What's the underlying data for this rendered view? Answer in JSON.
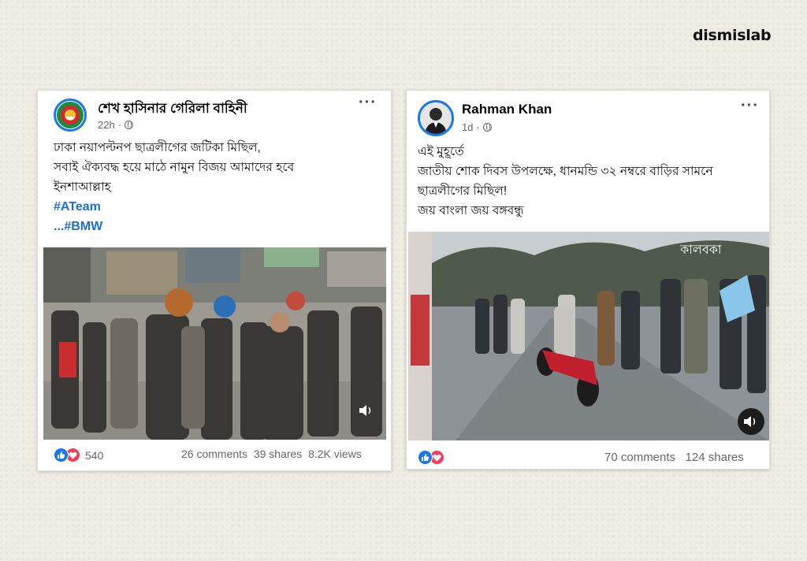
{
  "brand": "dismislab",
  "post1": {
    "author": "শেখ হাসিনার গেরিলা বাহিনী",
    "time": "22h",
    "text_lines": [
      "ঢাকা নয়াপল্টনপ ছাত্রলীগের জটিকা মিছিল,",
      "সবাই ঐক্যবদ্ধ হয়ে মাঠে নামুন বিজয় আমাদের হবে",
      "ইনশাআল্লাহ"
    ],
    "hashtags": [
      "#ATeam",
      "...#BMW"
    ],
    "reaction_count": "540",
    "comments": "26 comments",
    "shares": "39 shares",
    "views": "8.2K views"
  },
  "post2": {
    "author": "Rahman Khan",
    "time": "1d",
    "text_lines": [
      "এই মুহূর্তে",
      "জাতীয় শোক দিবস উপলক্ষে, ধানমন্ডি ৩২ নম্বরে বাড়ির সামনে",
      "ছাত্রলীগের মিছিল!",
      "জয় বাংলা জয় বঙ্গবন্ধু"
    ],
    "comments": "70 comments",
    "shares": "124 shares",
    "video_watermark": "কালবকা"
  },
  "colors": {
    "accent": "#1877f2",
    "hashtag": "#1b6fd6",
    "love": "#f33e58",
    "background": "#efece4"
  },
  "icons": [
    "more-options-icon",
    "globe-icon",
    "sound-icon",
    "like-reaction-icon",
    "love-reaction-icon"
  ]
}
